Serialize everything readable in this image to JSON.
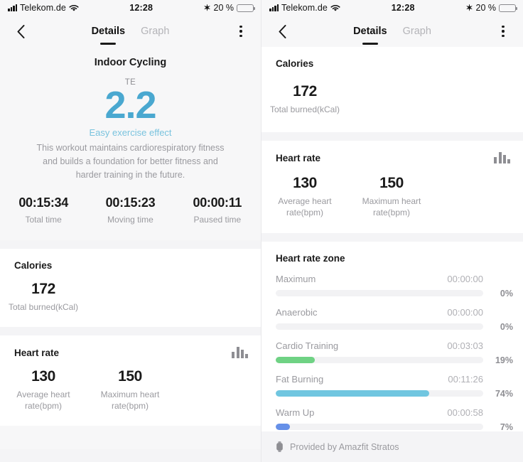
{
  "status_bar": {
    "carrier": "Telekom.de",
    "time": "12:28",
    "battery_percent": "20 %",
    "battery_level": 20,
    "signal_icon": "cellular-signal-icon",
    "wifi_icon": "wifi-icon",
    "bluetooth_icon": "bluetooth-icon",
    "battery_icon": "battery-icon",
    "battery_color": "#f0392b"
  },
  "nav": {
    "back_icon": "back-chevron-icon",
    "menu_icon": "kebab-menu-icon",
    "tabs": [
      {
        "label": "Details",
        "active": true
      },
      {
        "label": "Graph",
        "active": false
      }
    ]
  },
  "hero": {
    "sport": "Indoor Cycling",
    "te_label": "TE",
    "te_value": "2.2",
    "te_color": "#4aa8d0",
    "effect": "Easy exercise effect",
    "description": "This workout maintains cardiorespiratory fitness and builds a foundation for better fitness and harder training in the future."
  },
  "times": [
    {
      "value": "00:15:34",
      "caption": "Total time"
    },
    {
      "value": "00:15:23",
      "caption": "Moving time"
    },
    {
      "value": "00:00:11",
      "caption": "Paused time"
    }
  ],
  "calories": {
    "title": "Calories",
    "value": "172",
    "caption": "Total burned(kCal)"
  },
  "heart_rate": {
    "title": "Heart rate",
    "chart_icon": "bar-chart-icon",
    "metrics": [
      {
        "value": "130",
        "caption": "Average heart rate(bpm)"
      },
      {
        "value": "150",
        "caption": "Maximum heart rate(bpm)"
      }
    ]
  },
  "heart_rate_zone": {
    "title": "Heart rate zone",
    "zones": [
      {
        "name": "Maximum",
        "time": "00:00:00",
        "percent": "0%",
        "fill": 0,
        "color": "#f2f2f4"
      },
      {
        "name": "Anaerobic",
        "time": "00:00:00",
        "percent": "0%",
        "fill": 0,
        "color": "#f2f2f4"
      },
      {
        "name": "Cardio Training",
        "time": "00:03:03",
        "percent": "19%",
        "fill": 19,
        "color": "#6fd284"
      },
      {
        "name": "Fat Burning",
        "time": "00:11:26",
        "percent": "74%",
        "fill": 74,
        "color": "#70c6e0"
      },
      {
        "name": "Warm Up",
        "time": "00:00:58",
        "percent": "7%",
        "fill": 7,
        "color": "#6690e8"
      }
    ]
  },
  "footer": {
    "icon": "watch-device-icon",
    "text": "Provided by Amazfit Stratos"
  }
}
